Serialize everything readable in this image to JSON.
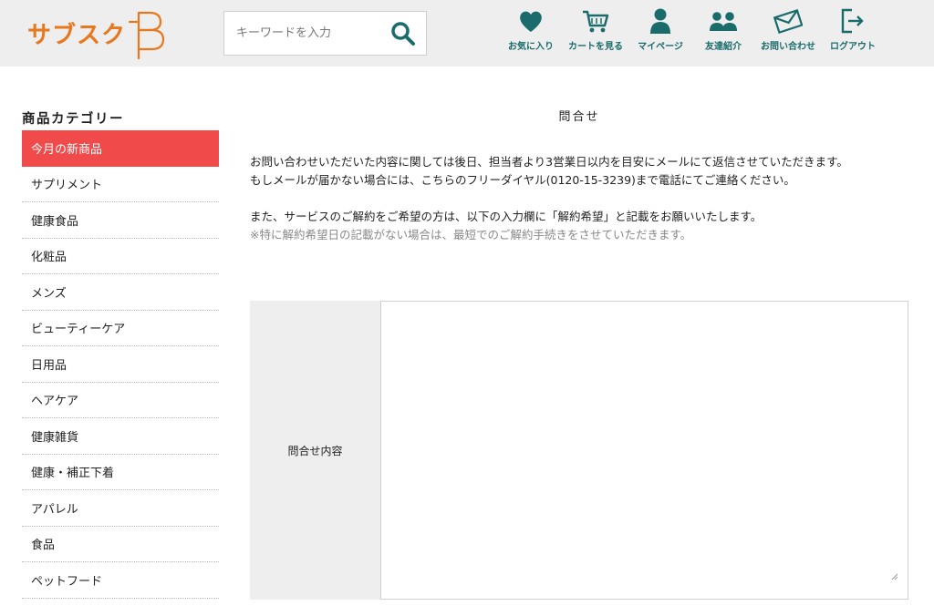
{
  "logo": {
    "text": "サブスク",
    "mark": "B"
  },
  "search": {
    "placeholder": "キーワードを入力",
    "value": ""
  },
  "nav": [
    {
      "label": "お気に入り",
      "icon": "heart-icon"
    },
    {
      "label": "カートを見る",
      "icon": "cart-icon"
    },
    {
      "label": "マイページ",
      "icon": "user-icon"
    },
    {
      "label": "友達紹介",
      "icon": "users-icon"
    },
    {
      "label": "お問い合わせ",
      "icon": "mail-icon"
    },
    {
      "label": "ログアウト",
      "icon": "logout-icon"
    }
  ],
  "sidebar": {
    "title": "商品カテゴリー",
    "items": [
      {
        "label": "今月の新商品",
        "active": true
      },
      {
        "label": "サプリメント"
      },
      {
        "label": "健康食品"
      },
      {
        "label": "化粧品"
      },
      {
        "label": "メンズ"
      },
      {
        "label": "ビューティーケア"
      },
      {
        "label": "日用品"
      },
      {
        "label": "ヘアケア"
      },
      {
        "label": "健康雑貨"
      },
      {
        "label": "健康・補正下着"
      },
      {
        "label": "アパレル"
      },
      {
        "label": "食品"
      },
      {
        "label": "ペットフード"
      }
    ]
  },
  "main": {
    "title": "問合せ",
    "paragraph1_line1": "お問い合わせいただいた内容に関しては後日、担当者より3営業日以内を目安にメールにて返信させていただきます。",
    "paragraph1_line2": "もしメールが届かない場合には、こちらのフリーダイヤル(0120-15-3239)まで電話にてご連絡ください。",
    "paragraph2": "また、サービスのご解約をご希望の方は、以下の入力欄に「解約希望」と記載をお願いいたします。",
    "note": "※特に解約希望日の記載がない場合は、最短でのご解約手続きをさせていただきます。"
  },
  "form": {
    "label": "問合せ内容",
    "value": ""
  },
  "colors": {
    "accent": "#f04a4a",
    "brand": "#e8781d",
    "icon": "#1a6b6b",
    "header_bg": "#eeeeee"
  }
}
